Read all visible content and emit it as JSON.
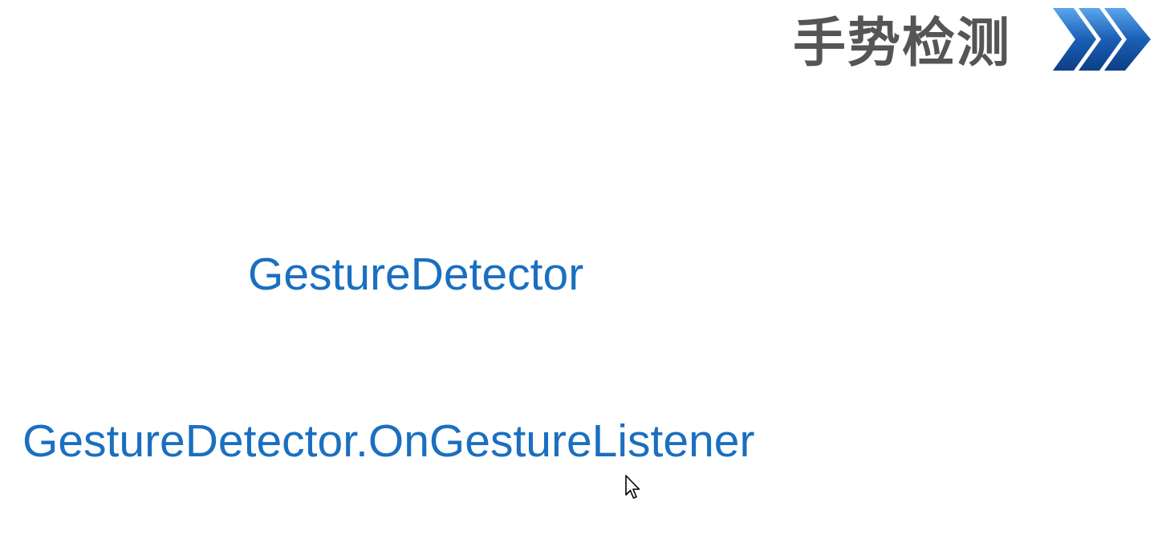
{
  "header": {
    "title": "手势检测",
    "icon": "triple-chevron-right-icon",
    "title_color": "#555555",
    "icon_color": "#1a5fb4"
  },
  "content": {
    "terms": [
      "GestureDetector",
      "GestureDetector.OnGestureListener"
    ],
    "text_color": "#1a6fc0"
  },
  "cursor": {
    "icon": "mouse-pointer-icon"
  }
}
